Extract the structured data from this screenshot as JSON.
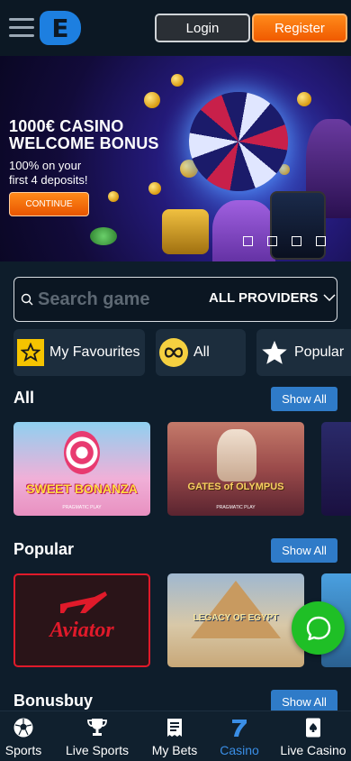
{
  "header": {
    "login_label": "Login",
    "register_label": "Register",
    "logo_icon": "brand-logo-icon",
    "menu_icon": "hamburger-icon"
  },
  "banner": {
    "title_line1": "1000€ CASINO",
    "title_line2": "WELCOME BONUS",
    "sub_line1": "100% on your",
    "sub_line2": "first 4 deposits!",
    "cta_label": "CONTINUE",
    "slide_count": 4
  },
  "search": {
    "placeholder": "Search game",
    "providers_label": "ALL PROVIDERS"
  },
  "categories": [
    {
      "label": "My Favourites",
      "icon": "star-icon"
    },
    {
      "label": "All",
      "icon": "infinity-icon"
    },
    {
      "label": "Popular",
      "icon": "star-icon"
    }
  ],
  "sections": {
    "all": {
      "title": "All",
      "show_all": "Show All"
    },
    "popular": {
      "title": "Popular",
      "show_all": "Show All"
    },
    "bonusbuy": {
      "title": "Bonusbuy",
      "show_all": "Show All"
    }
  },
  "games": {
    "sweet_bonanza": {
      "title": "SWEET BONANZA",
      "provider": "PRAGMATIC PLAY"
    },
    "gates_of_olympus": {
      "title": "GATES of OLYMPUS",
      "provider": "PRAGMATIC PLAY"
    },
    "aviator": {
      "title": "Aviator"
    },
    "legacy_of_egypt": {
      "title": "LEGACY OF EGYPT"
    }
  },
  "bottom_nav": [
    {
      "label": "Sports",
      "icon": "soccer-ball-icon"
    },
    {
      "label": "Live Sports",
      "icon": "trophy-icon"
    },
    {
      "label": "My Bets",
      "icon": "bet-slip-icon"
    },
    {
      "label": "Casino",
      "icon": "slot-seven-icon",
      "active": true
    },
    {
      "label": "Live Casino",
      "icon": "playing-card-icon"
    }
  ],
  "colors": {
    "background": "#0e1d2b",
    "accent_orange": "#f05a00",
    "accent_blue": "#2f7bc8",
    "chat_green": "#1fbf26",
    "nav_active": "#3a8ee6"
  }
}
